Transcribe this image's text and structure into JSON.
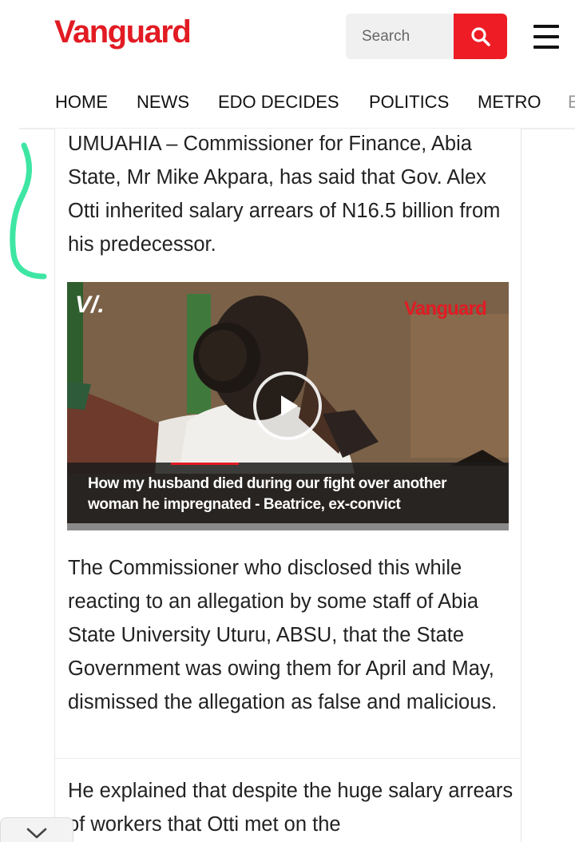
{
  "header": {
    "logo_text": "Vanguard",
    "search_placeholder": "Search",
    "brand_color": "#e21b23"
  },
  "nav": {
    "items": [
      {
        "label": "HOME"
      },
      {
        "label": "NEWS"
      },
      {
        "label": "EDO DECIDES"
      },
      {
        "label": "POLITICS"
      },
      {
        "label": "METRO"
      },
      {
        "label": "E"
      }
    ]
  },
  "article": {
    "paragraphs": [
      "UMUAHIA – Commissioner for Finance, Abia State, Mr Mike Akpara, has said that Gov. Alex Otti inherited salary arrears of N16.5 billion from his predecessor.",
      "The Commissioner who disclosed this while reacting to an allegation by some staff of Abia State University Uturu, ABSU, that the State Government was owing them for April and May, dismissed the allegation as false and malicious.",
      "He explained that despite the huge salary arrears of workers that Otti met on the"
    ]
  },
  "video": {
    "logo_glyph": "V/.",
    "brand": "Vanguard",
    "caption": "How my husband died during our fight over another woman he impregnated - Beatrice, ex-convict"
  },
  "annotation": {
    "color": "#3ee6a4"
  },
  "icons": {
    "search": "search-icon",
    "menu": "hamburger-menu-icon",
    "play": "play-icon",
    "collapse": "chevron-down-icon"
  }
}
